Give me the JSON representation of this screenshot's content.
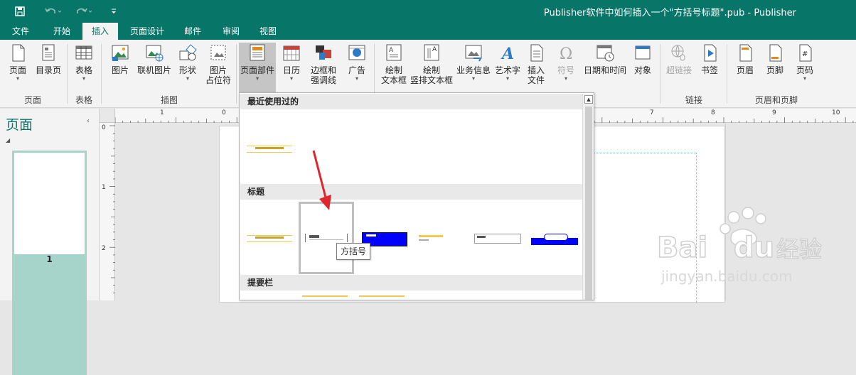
{
  "window": {
    "title": "Publisher软件中如何插入一个\"方括号标题\".pub - Publisher"
  },
  "quick_access": {
    "icons": [
      "save-icon",
      "undo-icon",
      "redo-icon",
      "customize-icon"
    ]
  },
  "tabs": [
    "文件",
    "开始",
    "插入",
    "页面设计",
    "邮件",
    "审阅",
    "视图"
  ],
  "active_tab": "插入",
  "ribbon": {
    "buttons": {
      "page": "页面",
      "catalog_page": "目录页",
      "table": "表格",
      "picture": "图片",
      "online_picture": "联机图片",
      "shapes": "形状",
      "picture_placeholder_1": "图片",
      "picture_placeholder_2": "占位符",
      "page_parts": "页面部件",
      "calendar": "日历",
      "borders_1": "边框和",
      "borders_2": "强调线",
      "ads": "广告",
      "draw_textbox_1": "绘制",
      "draw_textbox_2": "文本框",
      "vertical_textbox_1": "绘制",
      "vertical_textbox_2": "竖排文本框",
      "business_info": "业务信息",
      "wordart": "艺术字",
      "insert_file_1": "插入",
      "insert_file_2": "文件",
      "symbol": "符号",
      "datetime": "日期和时间",
      "object": "对象",
      "hyperlink": "超链接",
      "bookmark": "书签",
      "header": "页眉",
      "footer": "页脚",
      "page_number": "页码"
    },
    "groups": {
      "pages": "页面",
      "tables": "表格",
      "illustrations": "插图",
      "links": "链接",
      "header_footer": "页眉和页脚"
    }
  },
  "pages_pane": {
    "title": "页面",
    "page_number": "1"
  },
  "ruler": {
    "h_labels": [
      "1",
      "0",
      "7",
      "8",
      "9",
      "10"
    ],
    "v_labels": [
      "0",
      "1",
      "2"
    ]
  },
  "gallery": {
    "sections": [
      "最近使用过的",
      "标题",
      "提要栏"
    ],
    "tooltip": "方括号"
  },
  "colors": {
    "accent": "#077568",
    "highlight_border": "#bfbfbf",
    "arrow": "#e0262d"
  }
}
